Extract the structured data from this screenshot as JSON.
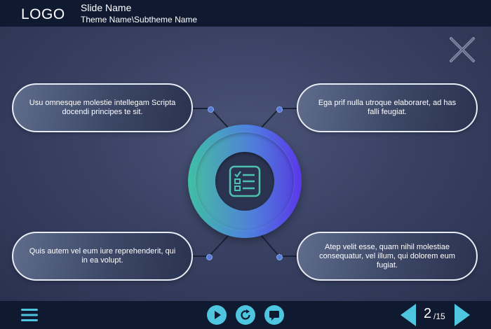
{
  "header": {
    "logo": "LOGO",
    "slide_name": "Slide Name",
    "theme_name": "Theme Name\\Subtheme Name"
  },
  "bubbles": {
    "top_left": "Usu omnesque molestie intellegam Scripta docendi principes te sit.",
    "top_right": "Ega prif nulla utroque elaboraret, ad has falli feugiat.",
    "bottom_left": "Quis autem vel eum iure reprehenderit, qui in ea volupt.",
    "bottom_right": "Atep velit esse, quam nihil molestiae consequatur, vel illum, qui dolorem eum fugiat."
  },
  "center": {
    "icon": "checklist-icon"
  },
  "footer": {
    "page_current": "2",
    "page_total": "/15",
    "icons": [
      "menu-icon",
      "play-icon",
      "replay-icon",
      "chat-icon",
      "prev-arrow-icon",
      "next-arrow-icon"
    ]
  },
  "colors": {
    "header_bg": "#0f1a30",
    "accent_cyan": "#4fc6e0",
    "ring_start": "#3fc0a4",
    "ring_end": "#5a38e8"
  }
}
